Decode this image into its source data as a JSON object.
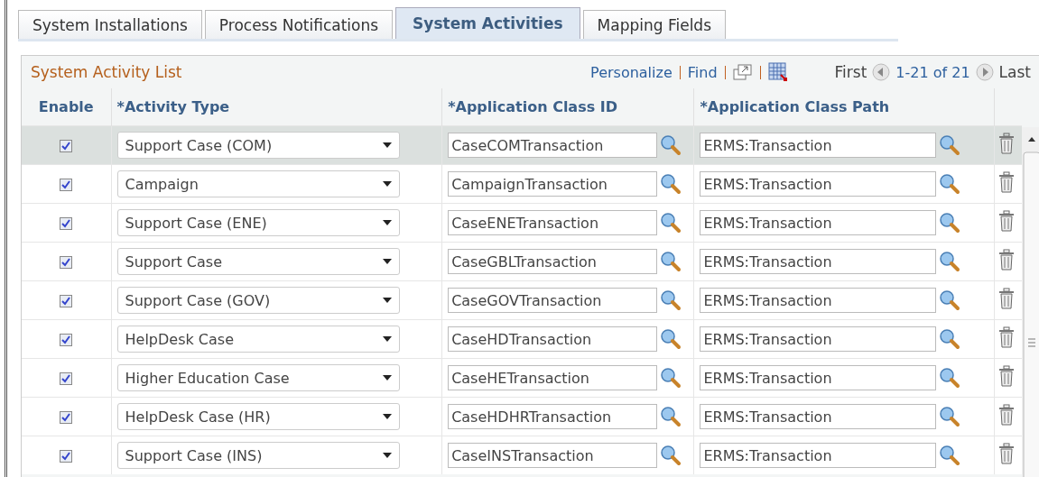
{
  "tabs": [
    {
      "label": "System Installations",
      "selected": false
    },
    {
      "label": "Process Notifications",
      "selected": false
    },
    {
      "label": "System Activities",
      "selected": true
    },
    {
      "label": "Mapping Fields",
      "selected": false
    }
  ],
  "grid": {
    "title": "System Activity List",
    "links": [
      "Personalize",
      "Find"
    ],
    "first": "First",
    "range": "1-21 of 21",
    "last": "Last",
    "columns": [
      "Enable",
      "*Activity Type",
      "*Application Class ID",
      "*Application Class Path"
    ],
    "rows": [
      {
        "enabled": true,
        "selected": true,
        "activity_type": "Support Case (COM)",
        "class_id": "CaseCOMTransaction",
        "class_path": "ERMS:Transaction"
      },
      {
        "enabled": true,
        "selected": false,
        "activity_type": "Campaign",
        "class_id": "CampaignTransaction",
        "class_path": "ERMS:Transaction"
      },
      {
        "enabled": true,
        "selected": false,
        "activity_type": "Support Case (ENE)",
        "class_id": "CaseENETransaction",
        "class_path": "ERMS:Transaction"
      },
      {
        "enabled": true,
        "selected": false,
        "activity_type": "Support Case",
        "class_id": "CaseGBLTransaction",
        "class_path": "ERMS:Transaction"
      },
      {
        "enabled": true,
        "selected": false,
        "activity_type": "Support Case (GOV)",
        "class_id": "CaseGOVTransaction",
        "class_path": "ERMS:Transaction"
      },
      {
        "enabled": true,
        "selected": false,
        "activity_type": "HelpDesk Case",
        "class_id": "CaseHDTransaction",
        "class_path": "ERMS:Transaction"
      },
      {
        "enabled": true,
        "selected": false,
        "activity_type": "Higher Education Case",
        "class_id": "CaseHETransaction",
        "class_path": "ERMS:Transaction"
      },
      {
        "enabled": true,
        "selected": false,
        "activity_type": "HelpDesk Case (HR)",
        "class_id": "CaseHDHRTransaction",
        "class_path": "ERMS:Transaction"
      },
      {
        "enabled": true,
        "selected": false,
        "activity_type": "Support Case (INS)",
        "class_id": "CaseINSTransaction",
        "class_path": "ERMS:Transaction"
      }
    ]
  }
}
